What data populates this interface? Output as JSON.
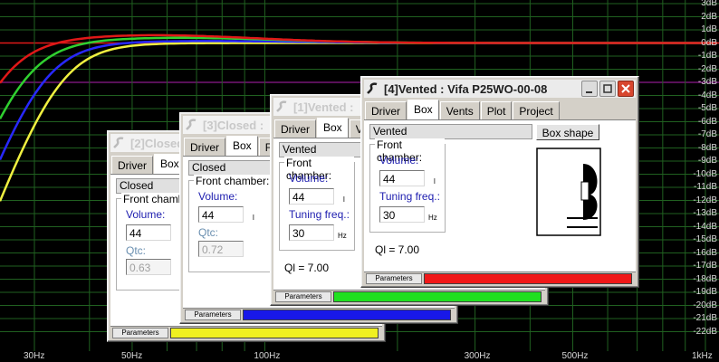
{
  "graph": {
    "y_labels": [
      "3dB",
      "2dB",
      "1dB",
      "0dB",
      "-1dB",
      "-2dB",
      "-3dB",
      "-4dB",
      "-5dB",
      "-6dB",
      "-7dB",
      "-8dB",
      "-9dB",
      "-10dB",
      "-11dB",
      "-12dB",
      "-13dB",
      "-14dB",
      "-15dB",
      "-16dB",
      "-17dB",
      "-18dB",
      "-19dB",
      "-20dB",
      "-21dB",
      "-22dB"
    ],
    "x_labels": [
      "30Hz",
      "50Hz",
      "100Hz",
      "300Hz",
      "500Hz",
      "1kHz"
    ],
    "colors": {
      "red": "#e01818",
      "green": "#30d030",
      "blue": "#2828ff",
      "yellow": "#f0f040",
      "grid": "#206020"
    }
  },
  "windows": {
    "w2": {
      "title": "[2]Closed",
      "tabs": [
        "Driver",
        "Box"
      ],
      "shape": "Closed",
      "group_title": "Front chamber:",
      "volume_label": "Volume:",
      "volume": "44",
      "volume_unit": "l",
      "qtc_label": "Qtc:",
      "qtc": "0.63",
      "params": "Parameters",
      "color": "#f0f020"
    },
    "w3": {
      "title": "[3]Closed :",
      "tabs": [
        "Driver",
        "Box",
        "F"
      ],
      "shape": "Closed",
      "group_title": "Front chamber:",
      "volume_label": "Volume:",
      "volume": "44",
      "volume_unit": "l",
      "qtc_label": "Qtc:",
      "qtc": "0.72",
      "params": "Parameters",
      "color": "#1818e8"
    },
    "w1": {
      "title": "[1]Vented :",
      "tabs": [
        "Driver",
        "Box",
        "V"
      ],
      "shape": "Vented",
      "group_title": "Front chamber:",
      "volume_label": "Volume:",
      "volume": "44",
      "volume_unit": "l",
      "tuning_label": "Tuning freq.:",
      "tuning": "30",
      "tuning_unit": "Hz",
      "ql": "Ql = 7.00",
      "params": "Parameters",
      "color": "#20e020"
    },
    "w4": {
      "title": "[4]Vented : Vifa P25WO-00-08",
      "tabs": [
        "Driver",
        "Box",
        "Vents",
        "Plot",
        "Project"
      ],
      "shape": "Vented",
      "box_shape_btn": "Box shape",
      "group_title": "Front chamber:",
      "volume_label": "Volume:",
      "volume": "44",
      "volume_unit": "l",
      "tuning_label": "Tuning freq.:",
      "tuning": "30",
      "tuning_unit": "Hz",
      "ql": "Ql = 7.00",
      "params": "Parameters",
      "color": "#f01818"
    }
  }
}
